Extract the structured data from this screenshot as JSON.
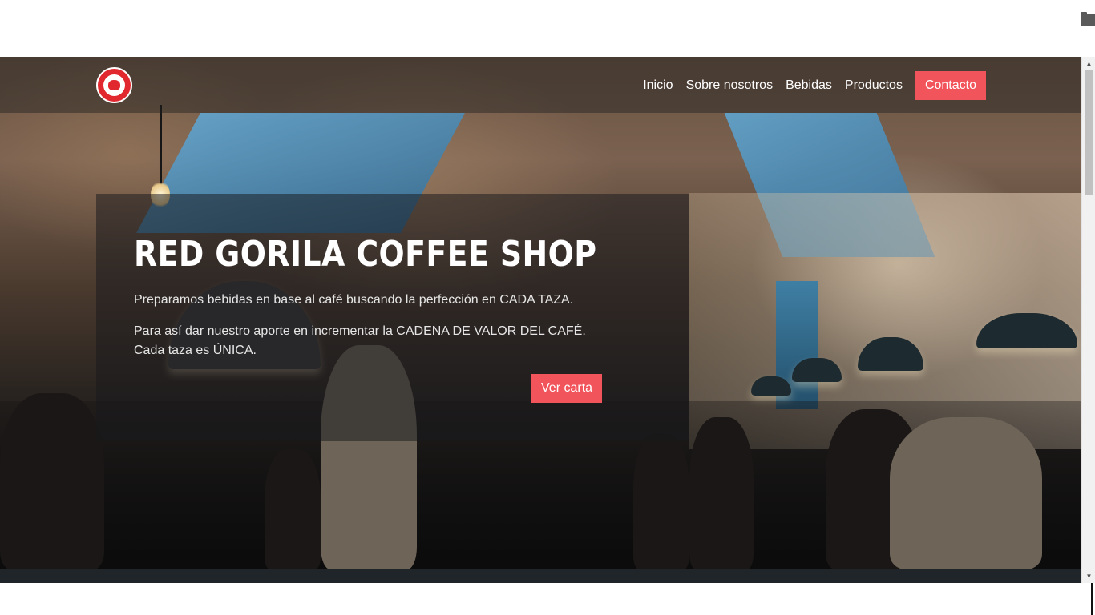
{
  "navbar": {
    "logo_icon": "red-gorilla-coffee-logo",
    "links": [
      {
        "label": "Inicio"
      },
      {
        "label": "Sobre nosotros"
      },
      {
        "label": "Bebidas"
      },
      {
        "label": "Productos"
      }
    ],
    "cta_label": "Contacto",
    "cta_color": "#f2545b"
  },
  "hero": {
    "title": "RED GORILA COFFEE SHOP",
    "line1": "Preparamos bebidas en base al café buscando la perfección en CADA TAZA.",
    "line2": "Para así dar nuestro aporte en incrementar la CADENA DE VALOR DEL CAFÉ.",
    "line3": "Cada taza es ÚNICA.",
    "button_label": "Ver carta",
    "accent_color": "#f2545b"
  },
  "browser": {
    "corner_icon": "folder-icon",
    "scroll_up_icon": "triangle-up-icon",
    "scroll_down_icon": "triangle-down-icon"
  }
}
